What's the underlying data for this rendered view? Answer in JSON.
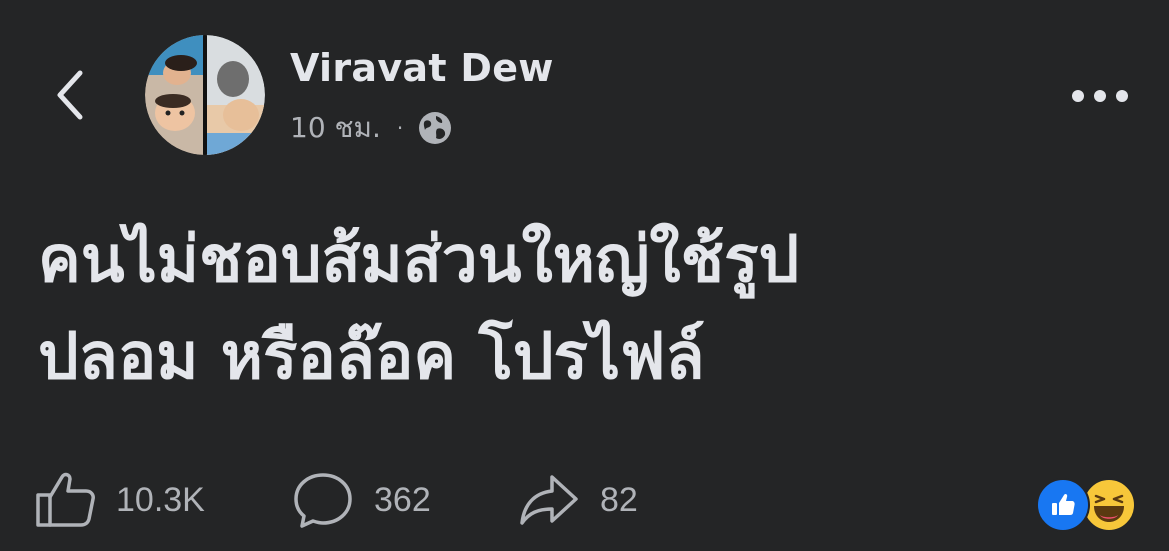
{
  "header": {
    "author_name": "Viravat Dew",
    "time": "10 ชม.",
    "separator": "·",
    "audience_icon": "globe-icon",
    "back_icon": "chevron-left-icon",
    "more_icon": "more-horizontal-icon"
  },
  "post": {
    "text_lines": [
      "คนไม่ชอบส้มส่วนใหญ่ใช้รูป",
      "ปลอม หรือล๊อค โปรไฟล์"
    ]
  },
  "footer": {
    "likes": "10.3K",
    "comments": "362",
    "shares": "82",
    "reactions": [
      "like",
      "haha"
    ]
  },
  "colors": {
    "background": "#242526",
    "primary_text": "#e4e6eb",
    "secondary_text": "#b0b3b8",
    "like_blue": "#1877f2",
    "haha_yellow": "#f7c73a"
  }
}
